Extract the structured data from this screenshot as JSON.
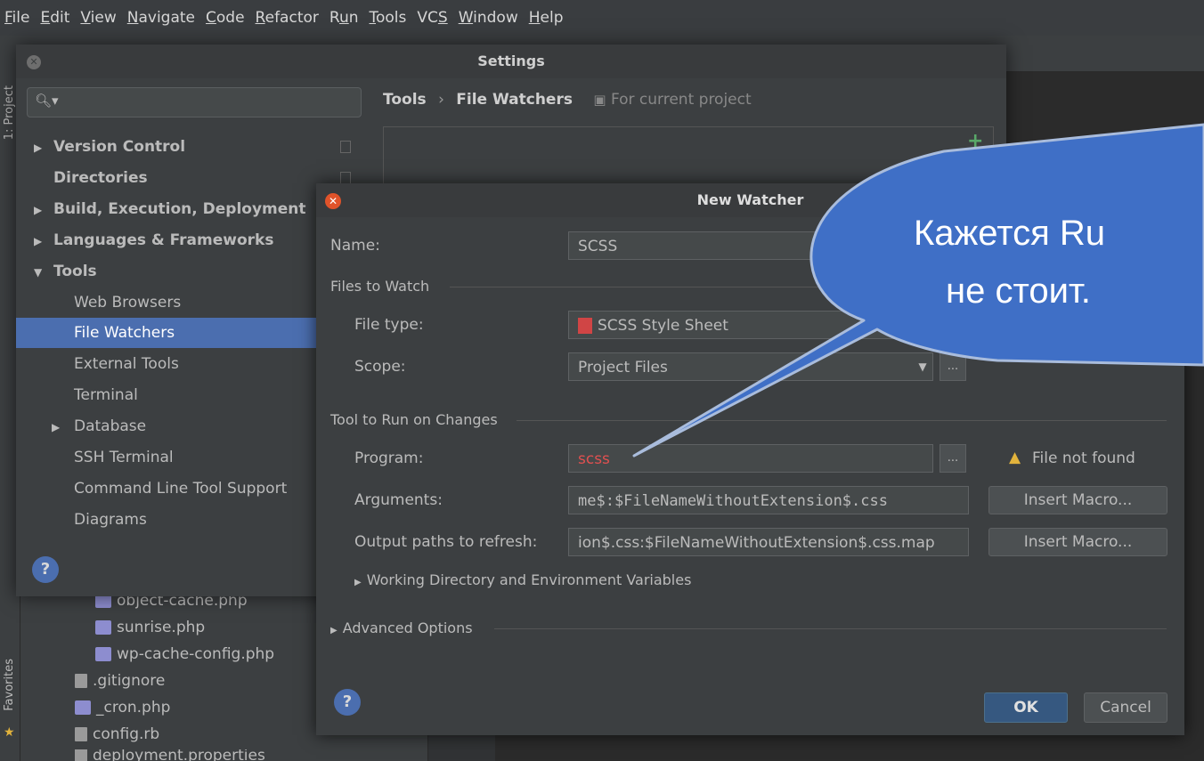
{
  "menu": [
    "File",
    "Edit",
    "View",
    "Navigate",
    "Code",
    "Refactor",
    "Run",
    "Tools",
    "VCS",
    "Window",
    "Help"
  ],
  "menu_mnemonic": [
    "F",
    "E",
    "V",
    "N",
    "C",
    "R",
    "u",
    "T",
    "S",
    "W",
    "H"
  ],
  "side": {
    "project_label": "1: Project",
    "favorites_label": "Favorites"
  },
  "project_tree": [
    "object-cache.php",
    "sunrise.php",
    "wp-cache-config.php",
    ".gitignore",
    "_cron.php",
    "config.rb",
    "deployment.properties"
  ],
  "settings": {
    "title": "Settings",
    "search_icon": "search-icon",
    "tree": [
      {
        "label": "Version Control",
        "expander": "▶",
        "bold": true
      },
      {
        "label": "Directories",
        "expander": "",
        "bold": true
      },
      {
        "label": "Build, Execution, Deployment",
        "expander": "▶",
        "bold": true
      },
      {
        "label": "Languages & Frameworks",
        "expander": "▶",
        "bold": true
      },
      {
        "label": "Tools",
        "expander": "▼",
        "bold": true
      },
      {
        "label": "Web Browsers",
        "expander": "",
        "bold": false
      },
      {
        "label": "File Watchers",
        "expander": "",
        "bold": false,
        "selected": true
      },
      {
        "label": "External Tools",
        "expander": "",
        "bold": false
      },
      {
        "label": "Terminal",
        "expander": "",
        "bold": false
      },
      {
        "label": "Database",
        "expander": "▶",
        "bold": false
      },
      {
        "label": "SSH Terminal",
        "expander": "",
        "bold": false
      },
      {
        "label": "Command Line Tool Support",
        "expander": "",
        "bold": false
      },
      {
        "label": "Diagrams",
        "expander": "",
        "bold": false
      }
    ],
    "breadcrumb": {
      "root": "Tools",
      "sep": "›",
      "leaf": "File Watchers",
      "scope": "For current project"
    },
    "add_symbol": "+",
    "help_symbol": "?"
  },
  "dialog": {
    "title": "New Watcher",
    "name_label": "Name:",
    "name_value": "SCSS",
    "files_section": "Files to Watch",
    "file_type_label": "File type:",
    "file_type_value": "SCSS Style Sheet",
    "scope_label": "Scope:",
    "scope_value": "Project Files",
    "tool_section": "Tool to Run on Changes",
    "program_label": "Program:",
    "program_value": "scss",
    "file_not_found": "File not found",
    "arguments_label": "Arguments:",
    "arguments_value": "me$:$FileNameWithoutExtension$.css",
    "output_label": "Output paths to refresh:",
    "output_value": "ion$.css:$FileNameWithoutExtension$.css.map",
    "insert_macro": "Insert Macro...",
    "working_dir": "Working Directory and Environment Variables",
    "advanced": "Advanced Options",
    "ok": "OK",
    "cancel": "Cancel",
    "dots": "...",
    "help_symbol": "?"
  },
  "callout": {
    "line1": "Кажется Ru",
    "line2": "не стоит.",
    "color": "#3f6fc6"
  }
}
